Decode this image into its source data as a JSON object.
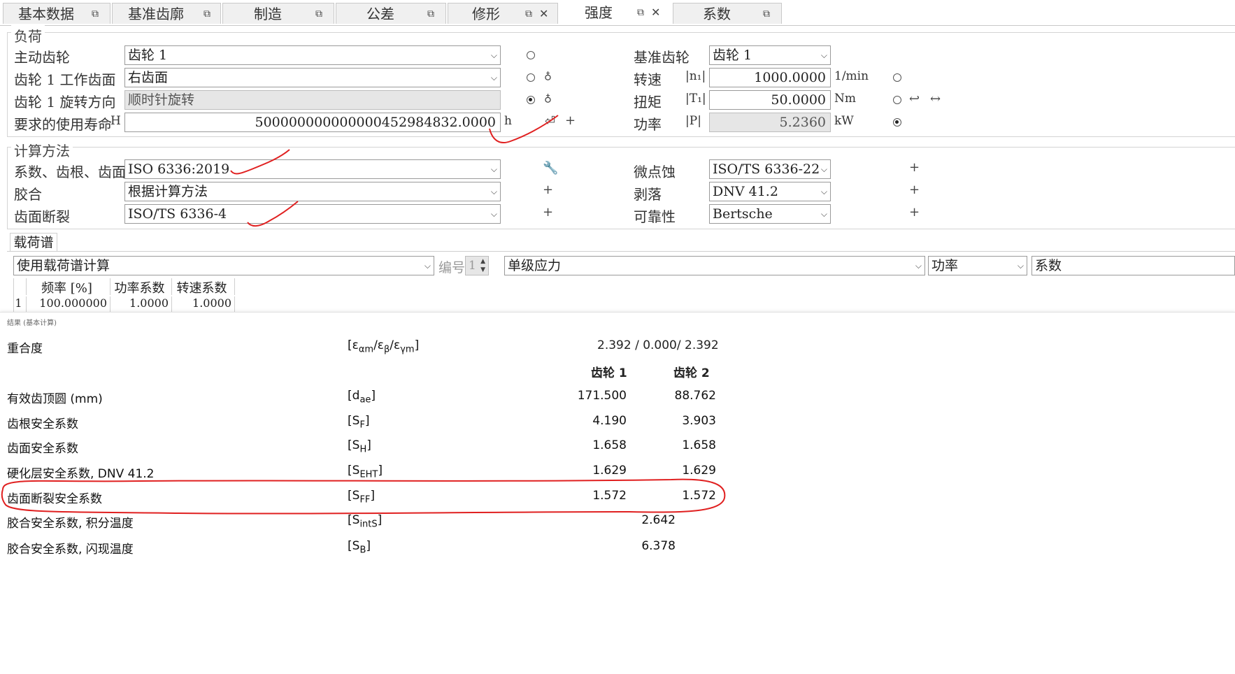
{
  "tabs": [
    {
      "label": "基本数据"
    },
    {
      "label": "基准齿廓"
    },
    {
      "label": "制造"
    },
    {
      "label": "公差"
    },
    {
      "label": "修形"
    },
    {
      "label": "强度"
    },
    {
      "label": "系数"
    }
  ],
  "load": {
    "title": "负荷",
    "driving_gear_label": "主动齿轮",
    "driving_gear_value": "齿轮 1",
    "flank_label": "齿轮 1 工作齿面",
    "flank_value": "右齿面",
    "rotation_label": "齿轮 1 旋转方向",
    "rotation_value": "顺时针旋转",
    "life_label": "要求的使用寿命",
    "life_sym": "H",
    "life_value": "500000000000000452984832.0000",
    "life_unit": "h",
    "ref_gear_label": "基准齿轮",
    "ref_gear_value": "齿轮 1",
    "speed_label": "转速",
    "speed_sym": "n₁",
    "speed_value": "1000.0000",
    "speed_unit": "1/min",
    "torque_label": "扭矩",
    "torque_sym": "T₁",
    "torque_value": "50.0000",
    "torque_unit": "Nm",
    "power_label": "功率",
    "power_sym": "P",
    "power_value": "5.2360",
    "power_unit": "kW"
  },
  "calc": {
    "title": "计算方法",
    "factors_label": "系数、齿根、齿面",
    "factors_value": "ISO 6336:2019",
    "scuffing_label": "胶合",
    "scuffing_value": "根据计算方法",
    "flank_fracture_label": "齿面断裂",
    "flank_fracture_value": "ISO/TS  6336-4",
    "micropitting_label": "微点蚀",
    "micropitting_value": "ISO/TS  6336-22",
    "spalling_label": "剥落",
    "spalling_value": "DNV 41.2",
    "reliability_label": "可靠性",
    "reliability_value": "Bertsche"
  },
  "spectrum": {
    "tab_label": "载荷谱",
    "mode_value": "使用载荷谱计算",
    "number_label": "编号",
    "number_value": "1",
    "stress_value": "单级应力",
    "power_value": "功率",
    "factor_value": "系数",
    "columns": [
      "频率 [%]",
      "功率系数",
      "转速系数"
    ],
    "rows": [
      {
        "idx": "1",
        "freq": "100.000000",
        "power": "1.0000",
        "speed": "1.0000"
      }
    ]
  },
  "results": {
    "caption": "结果 (基本计算)",
    "gear1": "齿轮 1",
    "gear2": "齿轮 2",
    "contact_ratio_label": "重合度",
    "contact_ratio_value": "2.392 /  0.000/ 2.392",
    "rows": [
      {
        "label": "有效齿顶圆 (mm)",
        "sym": "d",
        "sub": "ae",
        "v1": "171.500",
        "v2": "88.762"
      },
      {
        "label": "齿根安全系数",
        "sym": "S",
        "sub": "F",
        "v1": "4.190",
        "v2": "3.903"
      },
      {
        "label": "齿面安全系数",
        "sym": "S",
        "sub": "H",
        "v1": "1.658",
        "v2": "1.658"
      },
      {
        "label": "硬化层安全系数, DNV 41.2",
        "sym": "S",
        "sub": "EHT",
        "v1": "1.629",
        "v2": "1.629"
      },
      {
        "label": "齿面断裂安全系数",
        "sym": "S",
        "sub": "FF",
        "v1": "1.572",
        "v2": "1.572"
      }
    ],
    "single_rows": [
      {
        "label": "胶合安全系数, 积分温度",
        "sym": "S",
        "sub": "intS",
        "v": "2.642"
      },
      {
        "label": "胶合安全系数, 闪现温度",
        "sym": "S",
        "sub": "B",
        "v": "6.378"
      }
    ]
  },
  "annotation_color": "#e02020"
}
